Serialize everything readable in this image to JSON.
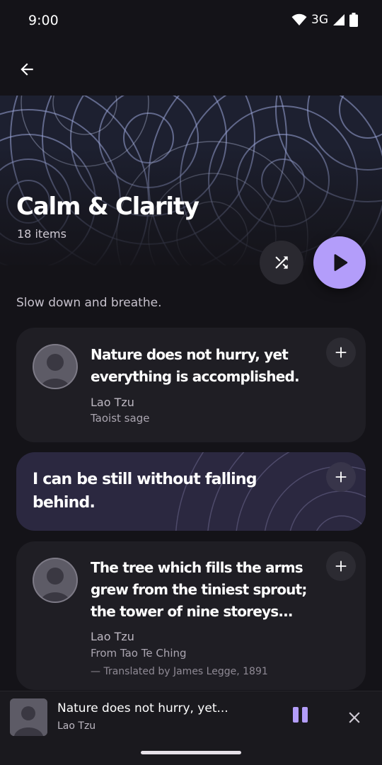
{
  "status": {
    "time": "9:00",
    "network": "3G"
  },
  "playlist": {
    "title": "Calm & Clarity",
    "count": "18 items",
    "description": "Slow down and breathe."
  },
  "cards": [
    {
      "quote": "Nature does not hurry, yet everything is accomplished.",
      "author": "Lao Tzu",
      "subtitle": "Taoist sage"
    },
    {
      "quote": "I can be still without falling behind."
    },
    {
      "quote": "The tree which fills the arms grew from the tiniest sprout; the tower of nine storeys...",
      "author": "Lao Tzu",
      "subtitle": "From Tao Te Ching",
      "credit": "— Translated by James Legge, 1891"
    }
  ],
  "mini_player": {
    "title": "Nature does not hurry, yet...",
    "author": "Lao Tzu"
  },
  "icons": {
    "back": "arrow-back-icon",
    "shuffle": "shuffle-icon",
    "play": "play-icon",
    "add": "add-icon",
    "pause": "pause-icon",
    "close": "close-icon",
    "wifi": "wifi-icon",
    "signal": "signal-icon",
    "battery": "battery-icon"
  },
  "colors": {
    "accent": "#b39dfa",
    "background": "#141318",
    "card": "#1f1e24"
  }
}
